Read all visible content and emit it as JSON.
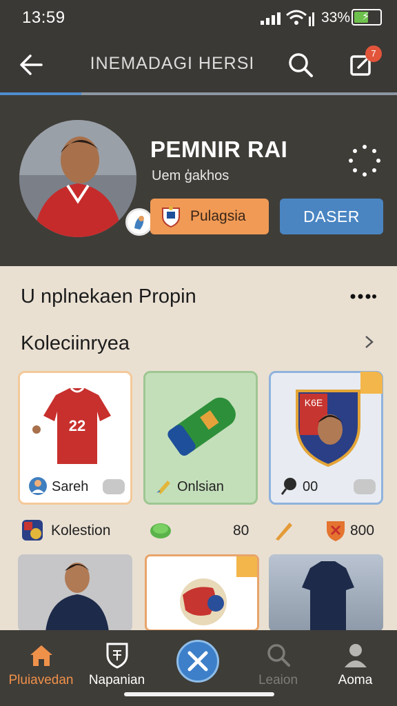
{
  "status": {
    "time": "13:59",
    "battery_pct": "33%",
    "battery_level": 0.55
  },
  "appbar": {
    "title": "INEMADAGI HERSI",
    "notif_count": "7"
  },
  "profile": {
    "name": "PEMNIR RAI",
    "subtitle": "Uem ģakhos",
    "primary_button": "Pulagsia",
    "secondary_button": "DASER"
  },
  "section": {
    "title": "U nplnekaen Propin"
  },
  "collection": {
    "title": "Koleciinryea",
    "cards": [
      {
        "label": "Sareh",
        "jersey_number": "22"
      },
      {
        "label": "Onlsian"
      },
      {
        "label": "00",
        "badge_text": "K6E"
      }
    ]
  },
  "stats": [
    {
      "label": "Kolestion"
    },
    {
      "value": "80"
    },
    {
      "value": "800"
    }
  ],
  "nav": [
    {
      "label": "Pluiavedan",
      "active": true
    },
    {
      "label": "Napanian"
    },
    {
      "label": ""
    },
    {
      "label": "Leaion"
    },
    {
      "label": "Aoma"
    }
  ],
  "colors": {
    "accent_orange": "#f0914a",
    "accent_blue": "#4a85c2",
    "header_bg": "#3f3d38"
  }
}
